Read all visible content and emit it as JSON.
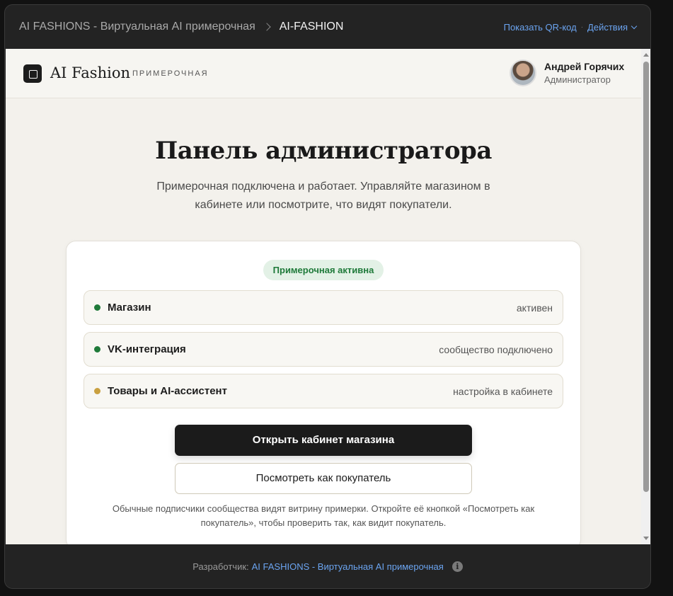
{
  "topbar": {
    "app_title": "AI FASHIONS - Виртуальная AI примерочная",
    "current": "AI-FASHION",
    "qr_label": "Показать QR-код",
    "separator": "·",
    "actions_label": "Действия"
  },
  "header": {
    "brand": "AI Fashion",
    "brand_sub": "ПРИМЕРОЧНАЯ",
    "user_name": "Андрей Горячих",
    "user_role": "Администратор"
  },
  "hero": {
    "title": "Панель администратора",
    "text": "Примерочная подключена и работает. Управляйте магазином в кабинете или посмотрите, что видят покупатели."
  },
  "card": {
    "status": "Примерочная активна",
    "rows": [
      {
        "label": "Магазин",
        "value": "активен",
        "color": "#1f7a3a"
      },
      {
        "label": "VK-интеграция",
        "value": "сообщество подключено",
        "color": "#1f7a3a"
      },
      {
        "label": "Товары и AI-ассистент",
        "value": "настройка в кабинете",
        "color": "#c9a040"
      }
    ],
    "primary_button": "Открыть кабинет магазина",
    "secondary_button": "Посмотреть как покупатель",
    "note": "Обычные подписчики сообщества видят витрину примерки. Откройте её кнопкой «Посмотреть как покупатель», чтобы проверить так, как видит покупатель."
  },
  "footer": {
    "prefix": "Разработчик:",
    "link": "AI FASHIONS - Виртуальная AI примерочная",
    "info_icon": "i"
  }
}
